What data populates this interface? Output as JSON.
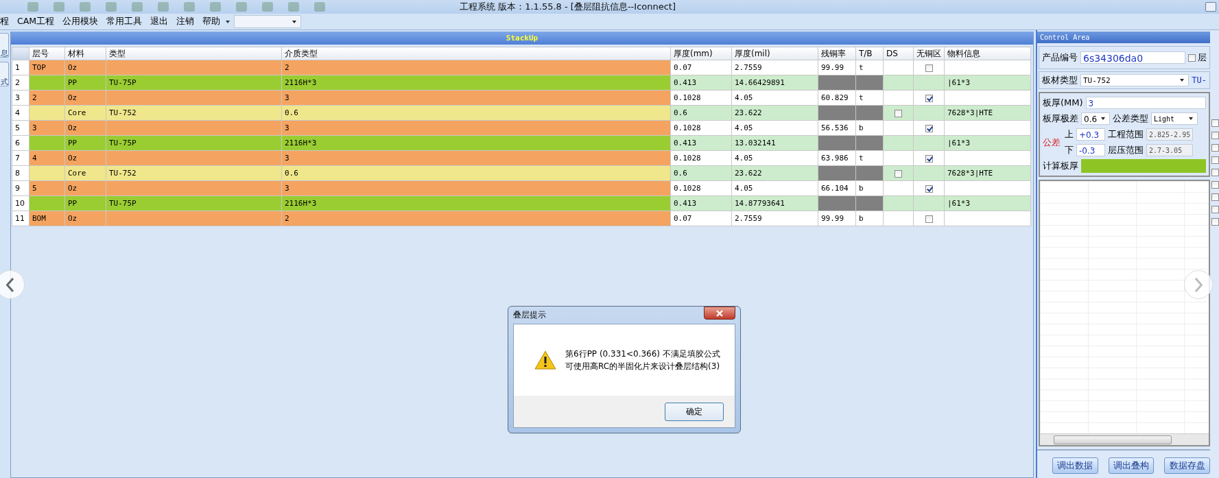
{
  "window": {
    "title": "工程系统   版本：1.1.55.8 - [叠层阻抗信息--Iconnect]"
  },
  "menu": {
    "items": [
      {
        "label": "程"
      },
      {
        "label": "CAM工程"
      },
      {
        "label": "公用模块"
      },
      {
        "label": "常用工具"
      },
      {
        "label": "退出"
      },
      {
        "label": "注销"
      },
      {
        "label": "帮助"
      }
    ]
  },
  "side_tabs": [
    {
      "label": "息"
    },
    {
      "label": "式"
    }
  ],
  "grid": {
    "title": "StackUp",
    "columns": [
      "层号",
      "材料",
      "类型",
      "介质类型",
      "厚度(mm)",
      "厚度(mil)",
      "残铜率",
      "T/B",
      "DS",
      "无铜区",
      "物料信息"
    ],
    "rows": [
      {
        "num": "1",
        "kind": "copper",
        "layer": "TOP",
        "material": "Oz",
        "type": "",
        "dielectric": "2",
        "thk_mm": "0.07",
        "thk_mil": "2.7559",
        "ratio": "99.99",
        "tb": "t",
        "no_copper_checked": false,
        "info": ""
      },
      {
        "num": "2",
        "kind": "pp",
        "layer": "",
        "material": "PP",
        "type": "TU-75P",
        "dielectric": "2116H*3",
        "thk_mm": "0.413",
        "thk_mil": "14.66429891",
        "info": "|61*3"
      },
      {
        "num": "3",
        "kind": "copper",
        "layer": "2",
        "material": "Oz",
        "type": "",
        "dielectric": "3",
        "thk_mm": "0.1028",
        "thk_mil": "4.05",
        "ratio": "60.829",
        "tb": "t",
        "no_copper_checked": true,
        "info": ""
      },
      {
        "num": "4",
        "kind": "core",
        "layer": "",
        "material": "Core",
        "type": "TU-752",
        "dielectric": "0.6",
        "thk_mm": "0.6",
        "thk_mil": "23.622",
        "ds_checked": false,
        "info": "7628*3|HTE"
      },
      {
        "num": "5",
        "kind": "copper",
        "layer": "3",
        "material": "Oz",
        "type": "",
        "dielectric": "3",
        "thk_mm": "0.1028",
        "thk_mil": "4.05",
        "ratio": "56.536",
        "tb": "b",
        "no_copper_checked": true,
        "info": ""
      },
      {
        "num": "6",
        "kind": "pp",
        "layer": "",
        "material": "PP",
        "type": "TU-75P",
        "dielectric": "2116H*3",
        "thk_mm": "0.413",
        "thk_mil": "13.032141",
        "info": "|61*3"
      },
      {
        "num": "7",
        "kind": "copper",
        "layer": "4",
        "material": "Oz",
        "type": "",
        "dielectric": "3",
        "thk_mm": "0.1028",
        "thk_mil": "4.05",
        "ratio": "63.986",
        "tb": "t",
        "no_copper_checked": true,
        "info": ""
      },
      {
        "num": "8",
        "kind": "core",
        "layer": "",
        "material": "Core",
        "type": "TU-752",
        "dielectric": "0.6",
        "thk_mm": "0.6",
        "thk_mil": "23.622",
        "ds_checked": false,
        "info": "7628*3|HTE"
      },
      {
        "num": "9",
        "kind": "copper",
        "layer": "5",
        "material": "Oz",
        "type": "",
        "dielectric": "3",
        "thk_mm": "0.1028",
        "thk_mil": "4.05",
        "ratio": "66.104",
        "tb": "b",
        "no_copper_checked": true,
        "info": ""
      },
      {
        "num": "10",
        "kind": "pp",
        "layer": "",
        "material": "PP",
        "type": "TU-75P",
        "dielectric": "2116H*3",
        "thk_mm": "0.413",
        "thk_mil": "14.87793641",
        "info": "|61*3"
      },
      {
        "num": "11",
        "kind": "copper",
        "layer": "BOM",
        "material": "Oz",
        "type": "",
        "dielectric": "2",
        "thk_mm": "0.07",
        "thk_mil": "2.7559",
        "ratio": "99.99",
        "tb": "b",
        "no_copper_checked": false,
        "info": ""
      }
    ]
  },
  "control_area": {
    "title": "Control Area",
    "product_no": {
      "label": "产品编号",
      "value": "6s34306da0"
    },
    "layer_check": {
      "label": "层",
      "checked": false
    },
    "board_material": {
      "label": "板材类型",
      "value": "TU-752",
      "extra": "TU-"
    },
    "thickness": {
      "label": "板厚(MM)",
      "value": "3"
    },
    "range": {
      "label": "板厚极差",
      "value": "0.6"
    },
    "tol_type": {
      "label": "公差类型",
      "value": "Light"
    },
    "tolerance": {
      "label": "公差",
      "upper_label": "上",
      "upper": "+0.3",
      "lower_label": "下",
      "lower": "-0.3"
    },
    "eng_range": {
      "label": "工程范围",
      "value": "2.825-2.95"
    },
    "press_range": {
      "label": "层压范围",
      "value": "2.7-3.05"
    },
    "calc": {
      "label": "计算板厚"
    },
    "buttons": [
      "调出数据",
      "调出叠构",
      "数据存盘"
    ],
    "strip_checks": [
      {
        "checked": false
      },
      {
        "checked": false
      },
      {
        "checked": false
      },
      {
        "checked": false
      },
      {
        "checked": false
      },
      {
        "checked": false
      },
      {
        "checked": false
      },
      {
        "checked": false
      },
      {
        "checked": false
      }
    ]
  },
  "dialog": {
    "title": "叠层提示",
    "lines": [
      "第6行PP (0.331<0.366) 不满足填胶公式",
      "可使用高RC的半固化片来设计叠层结构(3)"
    ],
    "ok": "确定"
  }
}
